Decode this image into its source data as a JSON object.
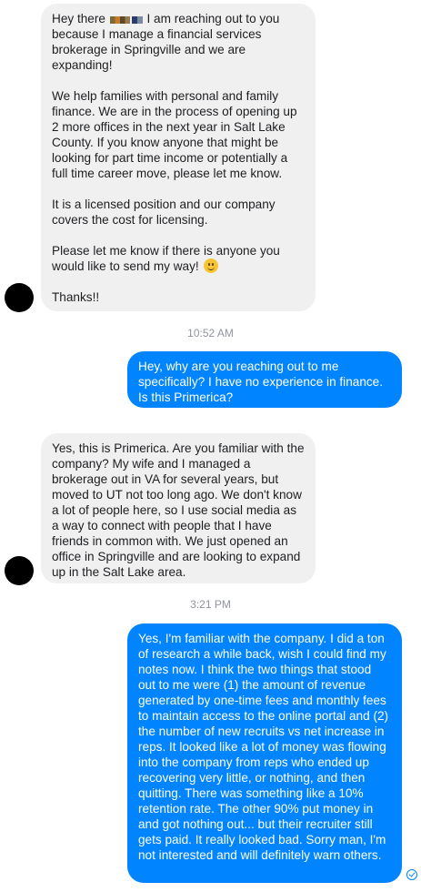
{
  "conversation": {
    "messages": [
      {
        "direction": "incoming",
        "greeting_prefix": "Hey there ",
        "greeting_suffix": " I am reaching out to you because I manage a financial services brokerage in Springville and we are expanding!",
        "para2": "We help families with personal and family finance. We are in the process of opening up 2 more offices in the next year in Salt Lake County. If you know anyone that might be looking for part time income or potentially a full time career move, please let me know.",
        "para3": "It is a licensed position and our company covers the cost for licensing.",
        "para4": "Please let me know if there is anyone you would like to send my way! ",
        "para5": "Thanks!!",
        "emoji": "slightly-smiling-face-icon"
      }
    ],
    "timestamp_1": "10:52 AM",
    "outgoing_1": "Hey, why are you reaching out to me specifically?  I have no experience in finance.  Is this Primerica?",
    "incoming_2": "Yes, this is Primerica. Are you familiar with the company? My wife and I managed a brokerage out in VA for several years, but moved to UT not too long ago. We don't know a lot of people here, so I use social media as a way to connect with people that I have friends in common with. We just opened an office in Springville and are looking to expand up in the Salt Lake area.",
    "timestamp_2": "3:21 PM",
    "outgoing_2": "Yes, I'm familiar with the company.  I did a ton of research a while back, wish I could find my notes now.  I think the two things that stood out to me were (1) the amount of revenue generated by one-time fees and monthly fees to maintain access to the online portal and (2) the number of new recruits vs net increase in reps.  It looked like a lot of money was flowing into the company from reps who ended up recovering very little, or nothing, and then quitting.  There was something like a 10% retention rate.  The other 90% put money in and got nothing out... but their recruiter still gets paid.  It really looked bad.  Sorry man, I'm not interested and will definitely warn others."
  },
  "colors": {
    "incoming_bubble": "#f1f0f0",
    "outgoing_bubble": "#0084ff",
    "timestamp": "#90949c"
  }
}
